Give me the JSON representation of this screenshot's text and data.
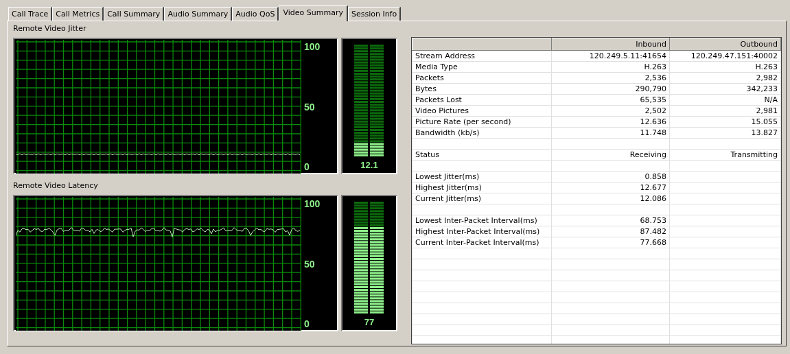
{
  "tabs": [
    {
      "label": "Call Trace",
      "selected": false
    },
    {
      "label": "Call Metrics",
      "selected": false
    },
    {
      "label": "Call Summary",
      "selected": false
    },
    {
      "label": "Audio Summary",
      "selected": false
    },
    {
      "label": "Audio QoS",
      "selected": false
    },
    {
      "label": "Video Summary",
      "selected": true
    },
    {
      "label": "Session Info",
      "selected": false
    }
  ],
  "graphs": [
    {
      "title": "Remote Video Jitter",
      "ticks": [
        "100",
        "50",
        "0"
      ],
      "meter": {
        "level": 0.121,
        "reading": "12.1"
      }
    },
    {
      "title": "Remote Video Latency",
      "ticks": [
        "100",
        "50",
        "0"
      ],
      "meter": {
        "level": 0.77,
        "reading": "77"
      }
    }
  ],
  "table": {
    "columns": [
      "Inbound",
      "Outbound"
    ],
    "rows": [
      {
        "kind": "data",
        "label": "Stream Address",
        "inbound": "120.249.5.11:41654",
        "outbound": "120.249.47.151:40002"
      },
      {
        "kind": "data",
        "label": "Media Type",
        "inbound": "H.263",
        "outbound": "H.263"
      },
      {
        "kind": "data",
        "label": "Packets",
        "inbound": "2,536",
        "outbound": "2,982"
      },
      {
        "kind": "data",
        "label": "Bytes",
        "inbound": "290,790",
        "outbound": "342,233"
      },
      {
        "kind": "data",
        "label": "Packets Lost",
        "inbound": "65,535",
        "outbound": "N/A"
      },
      {
        "kind": "data",
        "label": "Video Pictures",
        "inbound": "2,502",
        "outbound": "2,981"
      },
      {
        "kind": "data",
        "label": "Picture Rate (per second)",
        "inbound": "12.636",
        "outbound": "15.055"
      },
      {
        "kind": "data",
        "label": "Bandwidth (kb/s)",
        "inbound": "11.748",
        "outbound": "13.827"
      },
      {
        "kind": "blank"
      },
      {
        "kind": "data",
        "label": "Status",
        "inbound": "Receiving",
        "outbound": "Transmitting"
      },
      {
        "kind": "blank"
      },
      {
        "kind": "data",
        "label": "Lowest Jitter(ms)",
        "inbound": "0.858"
      },
      {
        "kind": "data",
        "label": "Highest Jitter(ms)",
        "inbound": "12.677"
      },
      {
        "kind": "data",
        "label": "Current Jitter(ms)",
        "inbound": "12.086"
      },
      {
        "kind": "blank"
      },
      {
        "kind": "data",
        "label": "Lowest Inter-Packet Interval(ms)",
        "inbound": "68.753"
      },
      {
        "kind": "data",
        "label": "Highest Inter-Packet Interval(ms)",
        "inbound": "87.482"
      },
      {
        "kind": "data",
        "label": "Current Inter-Packet Interval(ms)",
        "inbound": "77.668"
      }
    ]
  }
}
